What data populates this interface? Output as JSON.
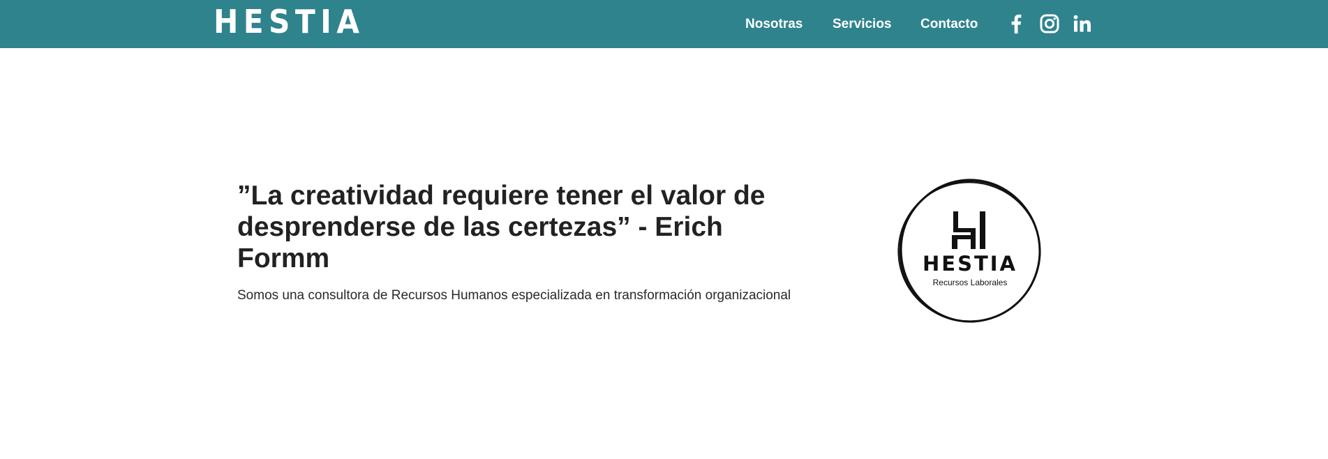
{
  "header": {
    "brand": "HESTIA",
    "nav": [
      "Nosotras",
      "Servicios",
      "Contacto"
    ],
    "social_icons": [
      "facebook-icon",
      "instagram-icon",
      "linkedin-icon"
    ],
    "background_color": "#2f838d"
  },
  "hero": {
    "quote": "”La creatividad requiere tener el valor de desprenderse de las certezas” - Erich Formm",
    "tagline": "Somos una consultora de Recursos Humanos especializada en transformación organizacional"
  },
  "logo": {
    "name": "HESTIA",
    "subtitle": "Recursos Laborales"
  }
}
